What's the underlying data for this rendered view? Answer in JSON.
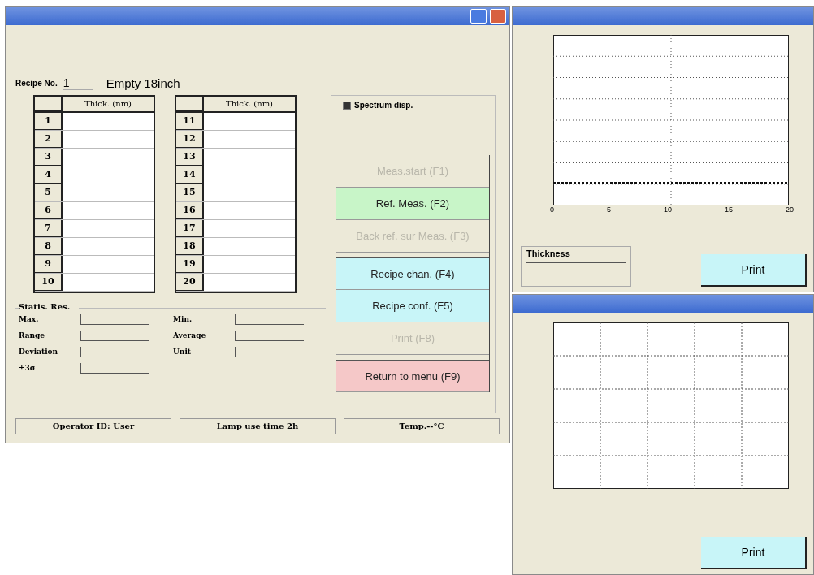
{
  "main_window": {
    "recipe_label": "Recipe No.",
    "recipe_no": "1",
    "recipe_name": "Empty 18inch",
    "tables": [
      {
        "header": "Thick. (nm)",
        "rows": [
          "1",
          "2",
          "3",
          "4",
          "5",
          "6",
          "7",
          "8",
          "9",
          "10"
        ]
      },
      {
        "header": "Thick. (nm)",
        "rows": [
          "11",
          "12",
          "13",
          "14",
          "15",
          "16",
          "17",
          "18",
          "19",
          "20"
        ]
      }
    ],
    "stats": {
      "title": "Statis. Res.",
      "left": [
        "Max.",
        "Range",
        "Deviation",
        "±3σ"
      ],
      "right": [
        "Min.",
        "Average",
        "Unit"
      ]
    },
    "spectrum_disp": {
      "label": "Spectrum disp.",
      "checked": true
    },
    "buttons": [
      {
        "label": "Meas.start (F1)",
        "disabled": true,
        "color": "#ece9d8",
        "gap_before": false
      },
      {
        "label": "Ref. Meas. (F2)",
        "disabled": false,
        "color": "#c8f5c8",
        "gap_before": false
      },
      {
        "label": "Back ref. sur Meas. (F3)",
        "disabled": true,
        "color": "#ece9d8",
        "gap_before": false
      },
      {
        "label": "Recipe chan. (F4)",
        "disabled": false,
        "color": "#c8f5f8",
        "gap_before": true
      },
      {
        "label": "Recipe conf. (F5)",
        "disabled": false,
        "color": "#c8f5f8",
        "gap_before": false
      },
      {
        "label": "Print (F8)",
        "disabled": true,
        "color": "#ece9d8",
        "gap_before": false
      },
      {
        "label": "Return to menu (F9)",
        "disabled": false,
        "color": "#f5c8c8",
        "gap_before": true
      }
    ],
    "status_bar": [
      "Operator ID: User",
      "Lamp use time 2h",
      "Temp.--°C"
    ]
  },
  "thickness_window": {
    "x_ticks": [
      "0",
      "5",
      "10",
      "15",
      "20"
    ],
    "group_label": "Thickness",
    "print_button": "Print"
  },
  "spectrum_window": {
    "print_button": "Print"
  }
}
